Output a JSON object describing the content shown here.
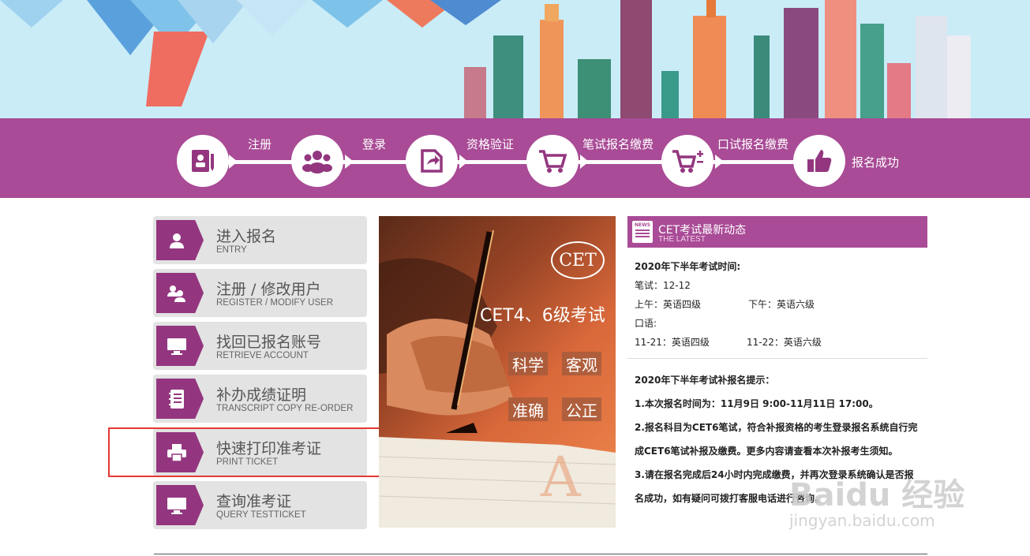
{
  "steps": [
    {
      "label": "注册",
      "icon": "registration-form-icon"
    },
    {
      "label": "登录",
      "icon": "users-group-icon"
    },
    {
      "label": "资格验证",
      "icon": "share-verify-icon"
    },
    {
      "label": "笔试报名缴费",
      "icon": "shopping-cart-icon"
    },
    {
      "label": "口试报名缴费",
      "icon": "cart-plus-minus-icon"
    },
    {
      "label": "报名成功",
      "icon": "thumbs-up-icon"
    }
  ],
  "menu": [
    {
      "title": "进入报名",
      "sub": "ENTRY",
      "icon": "user-icon"
    },
    {
      "title": "注册 / 修改用户",
      "sub": "REGISTER / MODIFY USER",
      "icon": "users-icon"
    },
    {
      "title": "找回已报名账号",
      "sub": "RETRIEVE ACCOUNT",
      "icon": "monitor-icon"
    },
    {
      "title": "补办成绩证明",
      "sub": "TRANSCRIPT COPY RE-ORDER",
      "icon": "notebook-icon"
    },
    {
      "title": "快速打印准考证",
      "sub": "PRINT TICKET",
      "icon": "printer-icon"
    },
    {
      "title": "查询准考证",
      "sub": "QUERY TESTTICKET",
      "icon": "monitor-icon"
    }
  ],
  "promo": {
    "logo": "CET",
    "headline": "CET4、6级考试",
    "tags": [
      "科学",
      "客观",
      "准确",
      "公正"
    ]
  },
  "news": {
    "title": "CET考试最新动态",
    "subtitle": "THE LATEST",
    "icon_text": "NEWS",
    "block1": {
      "heading": "2020年下半年考试时间:",
      "written": "笔试：12-12",
      "morning": "上午：英语四级",
      "afternoon": "下午：英语六级",
      "oral": "口语:",
      "oral_day1": "11-21：英语四级",
      "oral_day2": "11-22：英语六级"
    },
    "block2": {
      "heading": "2020年下半年考试补报名提示：",
      "item1": "1.本次报名时间为：11月9日 9:00-11月11日 17:00。",
      "item2a": "2.报名科目为CET6笔试，符合补报资格的考生登录报名系统自行完",
      "item2b": "成CET6笔试补报及缴费。更多内容请查看本次补报考生须知。",
      "item3a": "3.请在报名完成后24小时内完成缴费，并再次登录系统确认是否报",
      "item3b": "名成功，如有疑问可拨打客服电话进行咨询。"
    }
  },
  "watermark": {
    "brand": "Baidu 经验",
    "url": "jingyan.baidu.com"
  },
  "colors": {
    "purple": "#a94b96",
    "icon_purple": "#93367f",
    "highlight_red": "#e53935",
    "menu_bg": "#e3e3e3"
  }
}
